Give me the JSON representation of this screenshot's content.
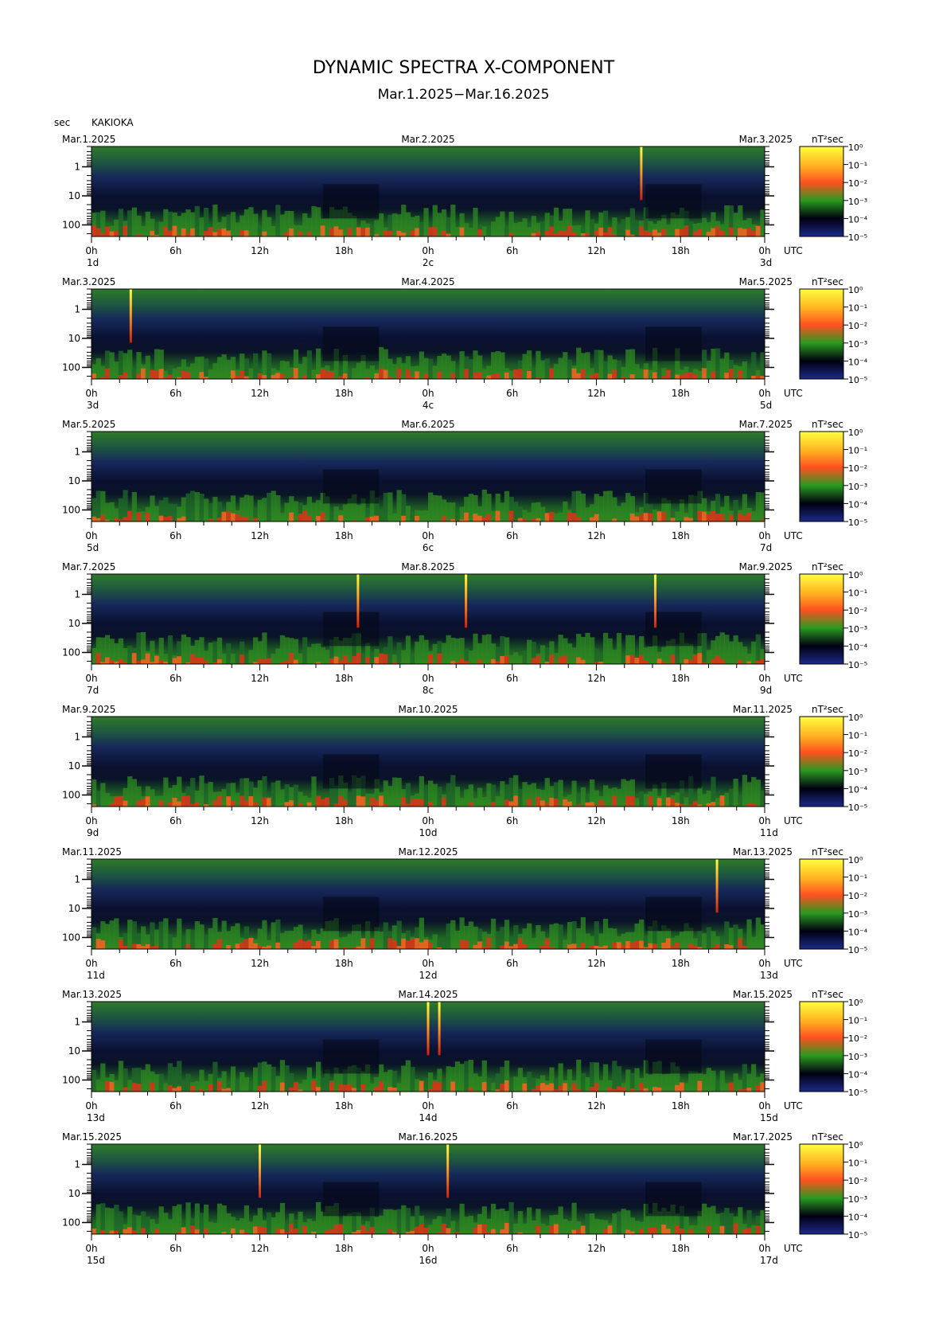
{
  "title": "DYNAMIC SPECTRA X-COMPONENT",
  "subtitle": "Mar.1.2025−Mar.16.2025",
  "y_unit_label": "sec",
  "station": "KAKIOKA",
  "chart_data": {
    "type": "heatmap",
    "x_axis": {
      "tick_labels": [
        "0h",
        "6h",
        "12h",
        "18h",
        "0h",
        "6h",
        "12h",
        "18h",
        "0h"
      ],
      "unit": "UTC"
    },
    "y_axis": {
      "tick_labels": [
        "1",
        "10",
        "100"
      ],
      "scale": "log",
      "inverted": true,
      "range_sec": [
        0.2,
        250
      ]
    },
    "colorbar": {
      "unit_label": "nT²sec",
      "tick_labels": [
        "10⁰",
        "10⁻¹",
        "10⁻²",
        "10⁻³",
        "10⁻⁴",
        "10⁻⁵"
      ],
      "colors": [
        "#ffff40",
        "#ff5020",
        "#2a9a20",
        "#000010",
        "#1c2a88"
      ]
    },
    "panels": [
      {
        "date_left": "Mar.1.2025",
        "date_mid": "Mar.2.2025",
        "date_right": "Mar.3.2025",
        "day_left": "1d",
        "day_mid": "2c",
        "day_right": "3d",
        "spikes_hours": [
          39.2
        ]
      },
      {
        "date_left": "Mar.3.2025",
        "date_mid": "Mar.4.2025",
        "date_right": "Mar.5.2025",
        "day_left": "3d",
        "day_mid": "4c",
        "day_right": "5d",
        "spikes_hours": [
          2.8
        ]
      },
      {
        "date_left": "Mar.5.2025",
        "date_mid": "Mar.6.2025",
        "date_right": "Mar.7.2025",
        "day_left": "5d",
        "day_mid": "6c",
        "day_right": "7d",
        "spikes_hours": []
      },
      {
        "date_left": "Mar.7.2025",
        "date_mid": "Mar.8.2025",
        "date_right": "Mar.9.2025",
        "day_left": "7d",
        "day_mid": "8c",
        "day_right": "9d",
        "spikes_hours": [
          19.0,
          26.7,
          40.2
        ]
      },
      {
        "date_left": "Mar.9.2025",
        "date_mid": "Mar.10.2025",
        "date_right": "Mar.11.2025",
        "day_left": "9d",
        "day_mid": "10d",
        "day_right": "11d",
        "spikes_hours": []
      },
      {
        "date_left": "Mar.11.2025",
        "date_mid": "Mar.12.2025",
        "date_right": "Mar.13.2025",
        "day_left": "11d",
        "day_mid": "12d",
        "day_right": "13d",
        "spikes_hours": [
          44.6
        ]
      },
      {
        "date_left": "Mar.13.2025",
        "date_mid": "Mar.14.2025",
        "date_right": "Mar.15.2025",
        "day_left": "13d",
        "day_mid": "14d",
        "day_right": "15d",
        "spikes_hours": [
          24.0,
          24.8
        ]
      },
      {
        "date_left": "Mar.15.2025",
        "date_mid": "Mar.16.2025",
        "date_right": "Mar.17.2025",
        "day_left": "15d",
        "day_mid": "16d",
        "day_right": "17d",
        "spikes_hours": [
          12.0,
          25.4
        ]
      }
    ]
  }
}
